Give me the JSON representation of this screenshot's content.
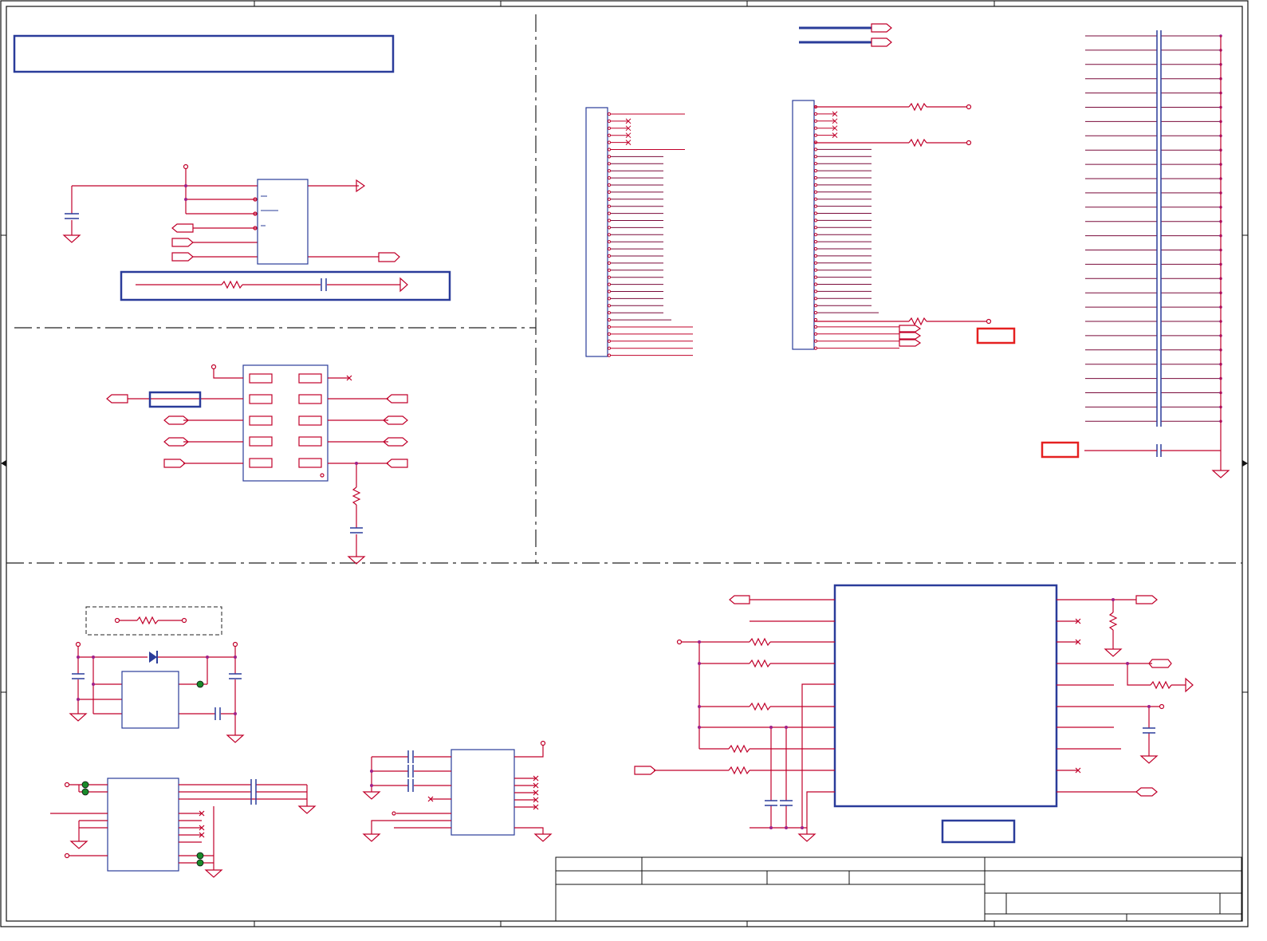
{
  "sheet": {
    "title": "",
    "size": "",
    "document_number": "",
    "revision": "",
    "date": "",
    "sheet_of": "",
    "colors": {
      "wire": "#c0002a",
      "net": "#7a0a3a",
      "component": "#2a3c9a",
      "frame": "#111111",
      "junction": "#a0208a",
      "highlight": "#e52020",
      "test_point": "#1a8a2a"
    }
  },
  "sections": [
    {
      "id": "regulator",
      "label": ""
    },
    {
      "id": "connectors",
      "label": ""
    },
    {
      "id": "card-slot",
      "label": ""
    },
    {
      "id": "power",
      "label": ""
    },
    {
      "id": "main-ic",
      "label": ""
    }
  ],
  "icons": [
    "ground-symbol",
    "power-flag",
    "resistor",
    "capacitor",
    "diode",
    "off-page-connector",
    "no-connect",
    "junction-dot",
    "test-point"
  ]
}
